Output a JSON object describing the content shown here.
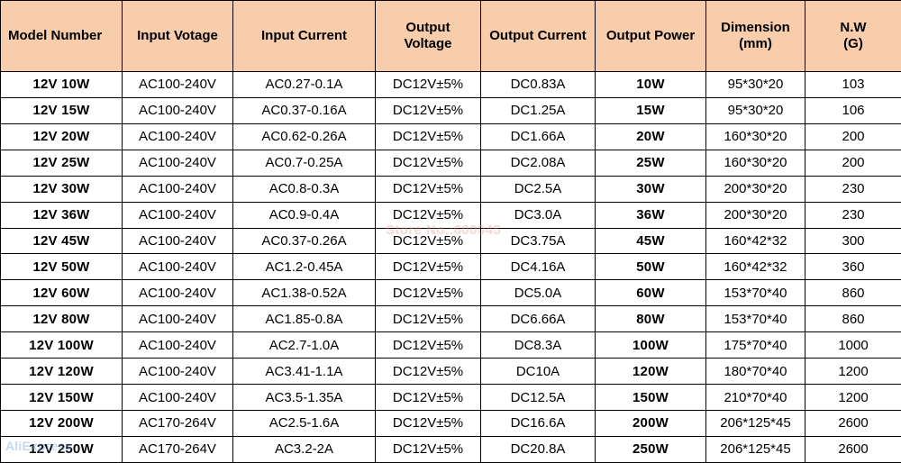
{
  "table": {
    "headers": [
      "Model Number",
      "Input Votage",
      "Input Current",
      "Output Voltage",
      "Output Current",
      "Output Power",
      "Dimension (mm)",
      "N.W (G)"
    ],
    "header_lines": {
      "model_number": "Model Number",
      "input_voltage": "Input Votage",
      "input_current": "Input Current",
      "output_voltage_l1": "Output",
      "output_voltage_l2": "Voltage",
      "output_current": "Output Current",
      "output_power": "Output Power",
      "dimension_l1": "Dimension",
      "dimension_l2": "(mm)",
      "nw_l1": "N.W",
      "nw_l2": "(G)"
    },
    "rows": [
      {
        "model": "12V 10W",
        "input_voltage": "AC100-240V",
        "input_current": "AC0.27-0.1A",
        "output_voltage": "DC12V±5%",
        "output_current": "DC0.83A",
        "output_power": "10W",
        "dimension": "95*30*20",
        "nw": "103"
      },
      {
        "model": "12V 15W",
        "input_voltage": "AC100-240V",
        "input_current": "AC0.37-0.16A",
        "output_voltage": "DC12V±5%",
        "output_current": "DC1.25A",
        "output_power": "15W",
        "dimension": "95*30*20",
        "nw": "106"
      },
      {
        "model": "12V 20W",
        "input_voltage": "AC100-240V",
        "input_current": "AC0.62-0.26A",
        "output_voltage": "DC12V±5%",
        "output_current": "DC1.66A",
        "output_power": "20W",
        "dimension": "160*30*20",
        "nw": "200"
      },
      {
        "model": "12V 25W",
        "input_voltage": "AC100-240V",
        "input_current": "AC0.7-0.25A",
        "output_voltage": "DC12V±5%",
        "output_current": "DC2.08A",
        "output_power": "25W",
        "dimension": "160*30*20",
        "nw": "200"
      },
      {
        "model": "12V 30W",
        "input_voltage": "AC100-240V",
        "input_current": "AC0.8-0.3A",
        "output_voltage": "DC12V±5%",
        "output_current": "DC2.5A",
        "output_power": "30W",
        "dimension": "200*30*20",
        "nw": "230"
      },
      {
        "model": "12V 36W",
        "input_voltage": "AC100-240V",
        "input_current": "AC0.9-0.4A",
        "output_voltage": "DC12V±5%",
        "output_current": "DC3.0A",
        "output_power": "36W",
        "dimension": "200*30*20",
        "nw": "230"
      },
      {
        "model": "12V 45W",
        "input_voltage": "AC100-240V",
        "input_current": "AC0.37-0.26A",
        "output_voltage": "DC12V±5%",
        "output_current": "DC3.75A",
        "output_power": "45W",
        "dimension": "160*42*32",
        "nw": "300"
      },
      {
        "model": "12V 50W",
        "input_voltage": "AC100-240V",
        "input_current": "AC1.2-0.45A",
        "output_voltage": "DC12V±5%",
        "output_current": "DC4.16A",
        "output_power": "50W",
        "dimension": "160*42*32",
        "nw": "360"
      },
      {
        "model": "12V 60W",
        "input_voltage": "AC100-240V",
        "input_current": "AC1.38-0.52A",
        "output_voltage": "DC12V±5%",
        "output_current": "DC5.0A",
        "output_power": "60W",
        "dimension": "153*70*40",
        "nw": "860"
      },
      {
        "model": "12V 80W",
        "input_voltage": "AC100-240V",
        "input_current": "AC1.85-0.8A",
        "output_voltage": "DC12V±5%",
        "output_current": "DC6.66A",
        "output_power": "80W",
        "dimension": "153*70*40",
        "nw": "860"
      },
      {
        "model": "12V 100W",
        "input_voltage": "AC100-240V",
        "input_current": "AC2.7-1.0A",
        "output_voltage": "DC12V±5%",
        "output_current": "DC8.3A",
        "output_power": "100W",
        "dimension": "175*70*40",
        "nw": "1000"
      },
      {
        "model": "12V 120W",
        "input_voltage": "AC100-240V",
        "input_current": "AC3.41-1.1A",
        "output_voltage": "DC12V±5%",
        "output_current": "DC10A",
        "output_power": "120W",
        "dimension": "180*70*40",
        "nw": "1200"
      },
      {
        "model": "12V 150W",
        "input_voltage": "AC100-240V",
        "input_current": "AC3.5-1.35A",
        "output_voltage": "DC12V±5%",
        "output_current": "DC12.5A",
        "output_power": "150W",
        "dimension": "210*70*40",
        "nw": "1200"
      },
      {
        "model": "12V 200W",
        "input_voltage": "AC170-264V",
        "input_current": "AC2.5-1.6A",
        "output_voltage": "DC12V±5%",
        "output_current": "DC16.6A",
        "output_power": "200W",
        "dimension": "206*125*45",
        "nw": "2600"
      },
      {
        "model": "12V 250W",
        "input_voltage": "AC170-264V",
        "input_current": "AC3.2-2A",
        "output_voltage": "DC12V±5%",
        "output_current": "DC20.8A",
        "output_power": "250W",
        "dimension": "206*125*45",
        "nw": "2600"
      }
    ]
  },
  "watermarks": {
    "center": "Store No.:600045",
    "corner": "AliExpress"
  },
  "colors": {
    "header_background": "#f7cdac",
    "accent_red": "#c8181f",
    "border": "#000000",
    "cell_background": "#ffffff"
  }
}
